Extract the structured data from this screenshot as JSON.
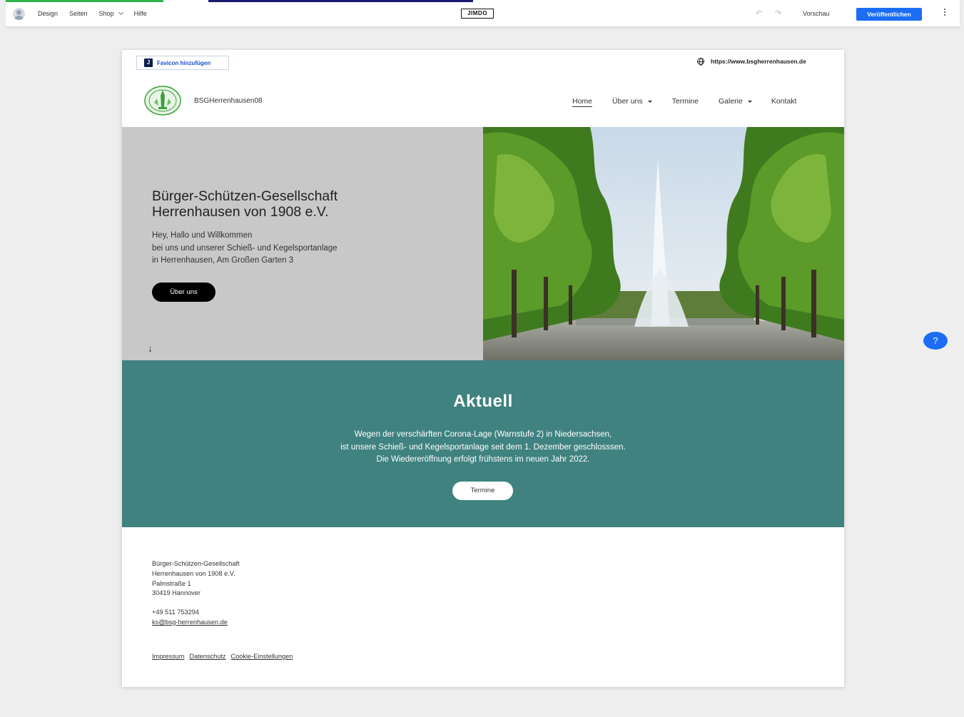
{
  "editor": {
    "nav": [
      "Design",
      "Seiten",
      "Shop",
      "Hilfe"
    ],
    "logo": "JIMDO",
    "preview": "Vorschau",
    "publish": "Veröffentlichen",
    "accent": "#1b6ef3"
  },
  "site": {
    "favicon_button": "Favicon hinzufügen",
    "domain": "https://www.bsgherrenhausen.de",
    "brand": "BSGHerrenhausen08",
    "nav": [
      "Home",
      "Über uns",
      "Termine",
      "Galerie",
      "Kontakt"
    ],
    "hero": {
      "title_line1": "Bürger-Schützen-Gesellschaft",
      "title_line2": "Herrenhausen von 1908 e.V.",
      "text_line1": "Hey, Hallo und Willkommen",
      "text_line2": "bei uns und unserer Schieß- und Kegelsportanlage",
      "text_line3": "in Herrenhausen, Am Großen Garten 3",
      "button": "Über uns",
      "scroll_arrow": "↓"
    },
    "aktuell": {
      "heading": "Aktuell",
      "line1": "Wegen der verschärften Corona-Lage (Warnstufe 2) in Niedersachsen,",
      "line2": "ist unsere Schieß- und Kegelsportanlage seit dem 1. Dezember geschlosssen.",
      "line3": "Die Wiedereröffnung erfolgt frühstens im neuen Jahr 2022.",
      "button": "Termine",
      "bg_color": "#3f8280"
    },
    "footer": {
      "address": [
        "Bürger-Schützen-Gesellschaft",
        "Herrenhausen von 1908 e.V.",
        "Palmstraße 1",
        "30419 Hannover"
      ],
      "phone": "+49 511 753294",
      "email": "ks@bsg-herrenhausen.de",
      "links": [
        "Impressum",
        "Datenschutz",
        "Cookie-Einstellungen"
      ]
    }
  },
  "help": "?"
}
